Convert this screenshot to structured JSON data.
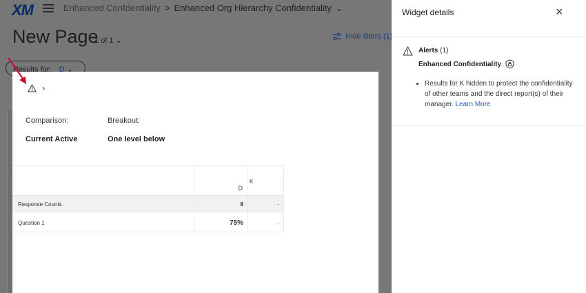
{
  "app": {
    "logo": "XM",
    "breadcrumb": {
      "parent": "Enhanced Confdentiality",
      "separator": ">",
      "current": "Enhanced Org Hierarchy Confidentiality"
    },
    "page_title": "New Page",
    "page_count": "1 of 1",
    "hide_filters_label": "Hide filters (1)",
    "filter": {
      "label": "Results for:",
      "value": "D"
    }
  },
  "widget": {
    "comparison_label": "Comparison:",
    "comparison_value": "Current Active",
    "breakout_label": "Breakout:",
    "breakout_value": "One level below",
    "table": {
      "columns": [
        "",
        "D",
        "K"
      ],
      "rows": [
        {
          "label": "Response Counts",
          "d": "8",
          "k": "-"
        },
        {
          "label": "Question 1",
          "d": "75%",
          "k": "-"
        }
      ]
    }
  },
  "panel": {
    "title": "Widget details",
    "alerts_label": "Alerts",
    "alerts_count": "(1)",
    "alert_name": "Enhanced Confidentiality",
    "alert_message": "Results for K hidden to protect the confidentiality of other teams and the direct report(s) of their manager.",
    "learn_more": "Learn More"
  },
  "colors": {
    "overlay": "#777777",
    "accent_link": "#1f5dbd",
    "arrow": "#c8102e"
  }
}
